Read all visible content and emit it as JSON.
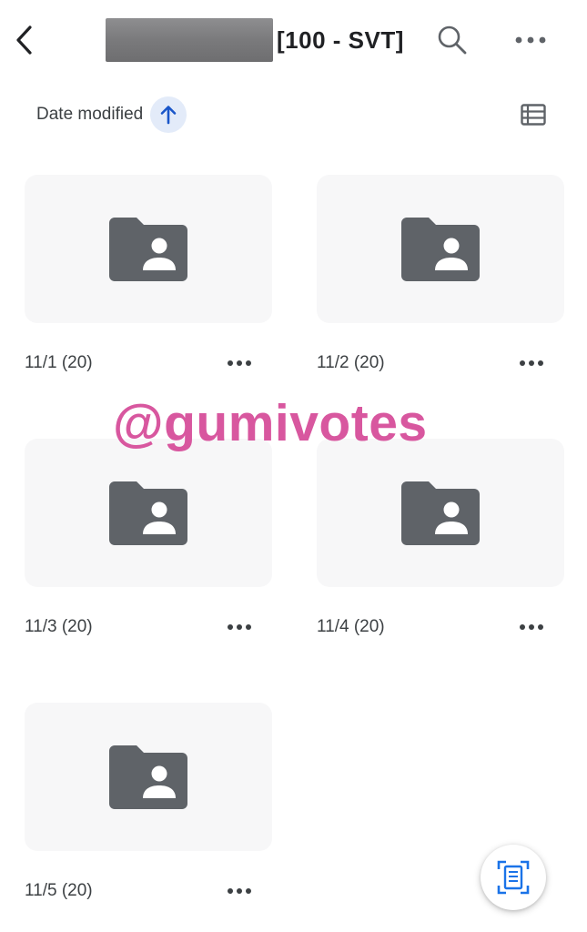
{
  "header": {
    "title_suffix": "[100 - SVT]",
    "back_icon": "chevron-left-icon",
    "search_icon": "search-icon",
    "more_icon": "more-horizontal-icon"
  },
  "sort": {
    "label": "Date modified",
    "direction_icon": "arrow-up-icon",
    "accent_color": "#1a56c9"
  },
  "view_toggle_icon": "list-view-icon",
  "folders": [
    {
      "name": "11/1 (20)",
      "icon": "shared-folder-icon"
    },
    {
      "name": "11/2 (20)",
      "icon": "shared-folder-icon"
    },
    {
      "name": "11/3 (20)",
      "icon": "shared-folder-icon"
    },
    {
      "name": "11/4 (20)",
      "icon": "shared-folder-icon"
    },
    {
      "name": "11/5 (20)",
      "icon": "shared-folder-icon"
    }
  ],
  "watermark": "@gumivotes",
  "fab": {
    "icon": "scan-document-icon",
    "color": "#1a73e8"
  },
  "colors": {
    "folder_icon": "#5f6368",
    "thumb_bg": "#f7f7f8",
    "watermark": "#d8579f"
  }
}
